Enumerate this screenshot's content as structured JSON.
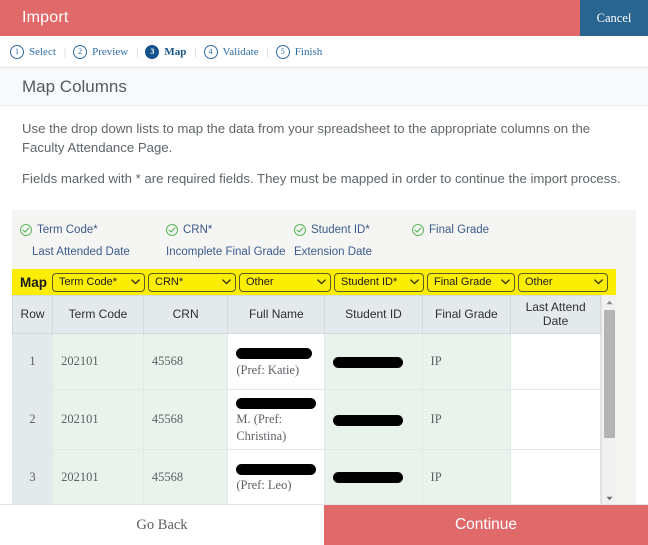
{
  "window": {
    "title": "Import",
    "cancel_label": "Cancel"
  },
  "wizard": {
    "separator": "|",
    "steps": [
      {
        "num": "1",
        "label": "Select",
        "active": false
      },
      {
        "num": "2",
        "label": "Preview",
        "active": false
      },
      {
        "num": "3",
        "label": "Map",
        "active": true
      },
      {
        "num": "4",
        "label": "Validate",
        "active": false
      },
      {
        "num": "5",
        "label": "Finish",
        "active": false
      }
    ]
  },
  "section": {
    "heading": "Map Columns",
    "paragraph_1": "Use the drop down lists to map the data from your spreadsheet to the appropriate columns on the Faculty Attendance Page.",
    "paragraph_2": "Fields marked with * are required fields. They must be mapped in order to continue the import process."
  },
  "field_flags": {
    "mapped": [
      {
        "label": "Term Code*",
        "icon": "check-circle-icon"
      },
      {
        "label": "CRN*",
        "icon": "check-circle-icon"
      },
      {
        "label": "Student ID*",
        "icon": "check-circle-icon"
      },
      {
        "label": "Final Grade",
        "icon": "check-circle-icon"
      }
    ],
    "unmapped": [
      {
        "label": "Last Attended Date"
      },
      {
        "label": "Incomplete Final Grade"
      },
      {
        "label": "Extension Date"
      }
    ]
  },
  "mapping": {
    "row_label": "Map",
    "highlight_color": "#fbed04",
    "dropdowns": [
      {
        "value": "Term Code*"
      },
      {
        "value": "CRN*"
      },
      {
        "value": "Other"
      },
      {
        "value": "Student ID*"
      },
      {
        "value": "Final Grade"
      },
      {
        "value": "Other"
      }
    ]
  },
  "table": {
    "headers": [
      "Row",
      "Term Code",
      "CRN",
      "Full Name",
      "Student ID",
      "Final Grade",
      "Last Attend Date"
    ],
    "rows": [
      {
        "row": "1",
        "term_code": "202101",
        "crn": "45568",
        "full_name_redacted": true,
        "full_name_pref": "(Pref: Katie)",
        "full_name_prefix": "",
        "student_id_redacted": true,
        "final_grade": "IP",
        "last_attend_date": ""
      },
      {
        "row": "2",
        "term_code": "202101",
        "crn": "45568",
        "full_name_redacted": true,
        "full_name_pref": "M. (Pref: Christina)",
        "full_name_prefix": "",
        "student_id_redacted": true,
        "final_grade": "IP",
        "last_attend_date": ""
      },
      {
        "row": "3",
        "term_code": "202101",
        "crn": "45568",
        "full_name_redacted": true,
        "full_name_pref": "(Pref: Leo)",
        "full_name_prefix": "",
        "student_id_redacted": true,
        "final_grade": "IP",
        "last_attend_date": ""
      }
    ]
  },
  "footer": {
    "go_back_label": "Go Back",
    "continue_label": "Continue"
  },
  "colors": {
    "brand_red": "#e0696a",
    "cancel_blue": "#2a6491",
    "highlight_yellow": "#fbed04",
    "mapped_green": "#e9f3ec",
    "check_green": "#5cb85c",
    "step_blue": "#2f6da4"
  }
}
